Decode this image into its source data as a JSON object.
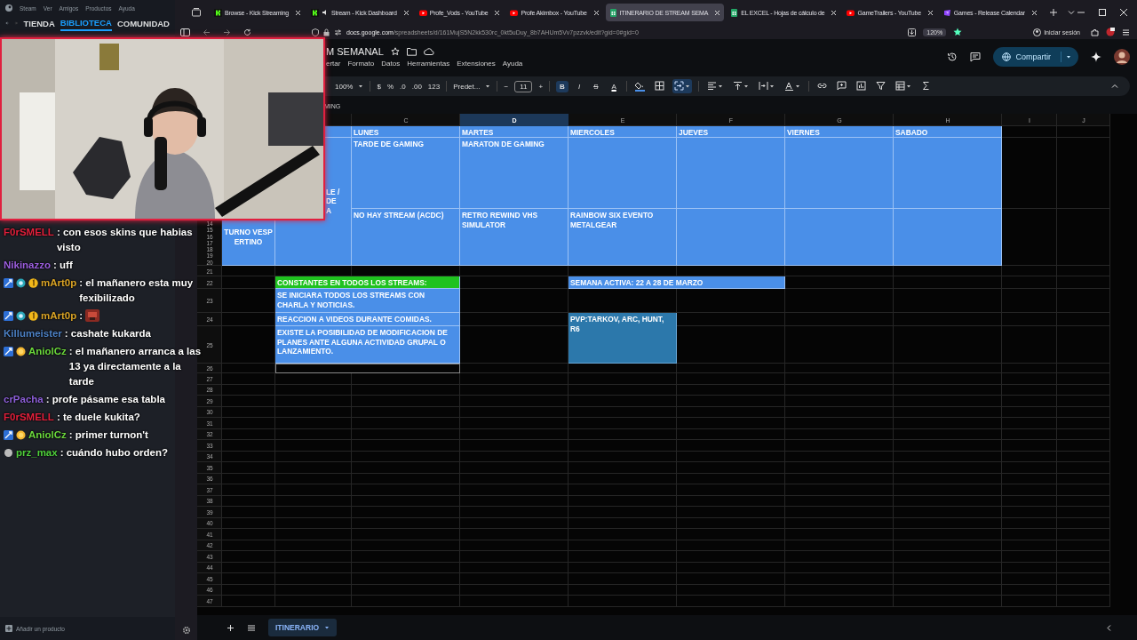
{
  "steam": {
    "menu": [
      "Steam",
      "Ver",
      "Amigos",
      "Productos",
      "Ayuda"
    ],
    "nav": [
      {
        "label": "TIENDA",
        "selected": false
      },
      {
        "label": "BIBLIOTECA",
        "selected": true
      },
      {
        "label": "COMUNIDAD",
        "selected": false
      }
    ],
    "add_product": "Añadir un producto"
  },
  "browser": {
    "tabs": [
      {
        "title": "Browse - Kick Streaming",
        "kind": "kick",
        "selected": false,
        "audio": false
      },
      {
        "title": "Stream - Kick Dashboard",
        "kind": "kick",
        "selected": false,
        "audio": true
      },
      {
        "title": "Profe_Vods - YouTube",
        "kind": "youtube",
        "selected": false,
        "audio": false
      },
      {
        "title": "Profe Akimbox - YouTube",
        "kind": "youtube",
        "selected": false,
        "audio": false
      },
      {
        "title": "ITINERARIO DE STREAM SEMA",
        "kind": "sheets",
        "selected": true,
        "audio": false
      },
      {
        "title": "EL EXCEL - Hojas de cálculo de",
        "kind": "sheets",
        "selected": false,
        "audio": false
      },
      {
        "title": "GameTrailers - YouTube",
        "kind": "youtube",
        "selected": false,
        "audio": false
      },
      {
        "title": "Games - Release Calendar",
        "kind": "games",
        "selected": false,
        "audio": false
      }
    ],
    "url": "docs.google.com/spreadsheets/d/161MujS5N2kk530rc_0kt5uDuy_8b7AHUm5Vv7pzzvk/edit?gid=0#gid=0",
    "zoom": "120%",
    "sign_in": "Iniciar sesión"
  },
  "sheet": {
    "title": "M SEMANAL",
    "menu": [
      "ertar",
      "Formato",
      "Datos",
      "Herramientas",
      "Extensiones",
      "Ayuda"
    ],
    "share": "Compartir",
    "toolbar": [
      {
        "kind": "dropdown",
        "label": "100%"
      },
      {
        "kind": "divider"
      },
      {
        "kind": "button",
        "label": "$"
      },
      {
        "kind": "button",
        "label": "%"
      },
      {
        "kind": "button",
        "label": ".0"
      },
      {
        "kind": "button",
        "label": ".00"
      },
      {
        "kind": "button",
        "label": "123"
      },
      {
        "kind": "divider"
      },
      {
        "kind": "dropdown",
        "label": "Predet..."
      },
      {
        "kind": "divider"
      },
      {
        "kind": "button",
        "label": "−"
      },
      {
        "kind": "field",
        "value": "11"
      },
      {
        "kind": "button",
        "label": "+"
      },
      {
        "kind": "divider"
      },
      {
        "kind": "toggle",
        "label": "B",
        "selected": true
      },
      {
        "kind": "toggle",
        "label": "I",
        "selected": false
      },
      {
        "kind": "toggle",
        "label": "S",
        "selected": false
      },
      {
        "kind": "toggle",
        "label": "A",
        "selected": false
      },
      {
        "kind": "divider"
      },
      {
        "kind": "icon",
        "selected": false
      },
      {
        "kind": "icon",
        "selected": false
      },
      {
        "kind": "icon",
        "selected": true
      },
      {
        "kind": "divider"
      },
      {
        "kind": "icon",
        "selected": false
      },
      {
        "kind": "icon",
        "selected": false
      },
      {
        "kind": "icon",
        "selected": false
      },
      {
        "kind": "icon",
        "selected": false
      },
      {
        "kind": "divider"
      },
      {
        "kind": "icon",
        "selected": false
      },
      {
        "kind": "icon",
        "selected": false
      },
      {
        "kind": "icon",
        "selected": false
      },
      {
        "kind": "icon",
        "selected": false
      },
      {
        "kind": "icon",
        "selected": false
      },
      {
        "kind": "icon",
        "selected": false
      }
    ],
    "formula": "MING",
    "columns": [
      {
        "label": "C",
        "selected": false
      },
      {
        "label": "D",
        "selected": true
      },
      {
        "label": "E",
        "selected": false
      },
      {
        "label": "F",
        "selected": false
      },
      {
        "label": "G",
        "selected": false
      },
      {
        "label": "H",
        "selected": false
      },
      {
        "label": "I",
        "selected": false
      },
      {
        "label": "J",
        "selected": false
      }
    ],
    "rows": [
      {
        "cells": [
          {
            "kind": "blank"
          },
          {
            "kind": "blue"
          },
          {
            "kind": "blue",
            "text": "LUNES"
          },
          {
            "kind": "blue",
            "text": "MARTES"
          },
          {
            "kind": "blue",
            "text": "MIERCOLES"
          },
          {
            "kind": "blue",
            "text": "JUEVES"
          },
          {
            "kind": "blue",
            "text": "VIERNES"
          },
          {
            "kind": "blue",
            "text": "SABADO"
          },
          {
            "kind": "blank"
          },
          {
            "kind": "blank"
          }
        ]
      },
      {
        "cells": [
          {
            "kind": "blank"
          },
          {
            "kind": "blue",
            "lines": [
              "LE /",
              "DE",
              "A"
            ]
          },
          {
            "kind": "blue",
            "text": "TARDE DE GAMING"
          },
          {
            "kind": "blue",
            "text": "MARATON DE GAMING"
          },
          {
            "kind": "blue"
          },
          {
            "kind": "blue"
          },
          {
            "kind": "blue"
          },
          {
            "kind": "blue"
          },
          {
            "kind": "blank"
          },
          {
            "kind": "blank"
          }
        ]
      },
      {
        "numbers": [
          "14",
          "15",
          "16",
          "17",
          "18",
          "19",
          "20"
        ],
        "cells": [
          {
            "kind": "blue",
            "text": "TURNO VESPERTINO",
            "centered": true
          },
          {
            "kind": "blue",
            "text": "NO HAY STREAM (ACDC)"
          },
          {
            "kind": "blue",
            "text": "RETRO REWIND VHS SIMULATOR"
          },
          {
            "kind": "blue",
            "text": "RAINBOW SIX EVENTO METALGEAR"
          },
          {
            "kind": "blue"
          },
          {
            "kind": "blue"
          },
          {
            "kind": "blue"
          },
          {
            "kind": "blank"
          },
          {
            "kind": "blank"
          }
        ]
      },
      {
        "numbers": [
          "21"
        ]
      },
      {
        "numbers": [
          "22"
        ],
        "cells": [
          {
            "kind": "blank"
          },
          {
            "kind": "green",
            "text": "CONSTANTES EN TODOS LOS STREAMS:"
          },
          {
            "kind": "blank"
          },
          {
            "kind": "blue",
            "text": "SEMANA ACTIVA: 22 A 28 DE MARZO"
          },
          {
            "kind": "blank"
          },
          {
            "kind": "blank"
          },
          {
            "kind": "blank"
          },
          {
            "kind": "blank"
          }
        ]
      },
      {
        "numbers": [
          "23"
        ],
        "cells": [
          {
            "kind": "blank"
          },
          {
            "kind": "blue",
            "text": "SE INICIARA TODOS LOS STREAMS CON CHARLA Y NOTICIAS."
          },
          {
            "kind": "blank"
          },
          {
            "kind": "blank"
          },
          {
            "kind": "blank"
          },
          {
            "kind": "blank"
          },
          {
            "kind": "blank"
          },
          {
            "kind": "blank"
          },
          {
            "kind": "blank"
          }
        ]
      },
      {
        "numbers": [
          "24"
        ],
        "cells": [
          {
            "kind": "blank"
          },
          {
            "kind": "blue",
            "text": "REACCION A VIDEOS DURANTE COMIDAS."
          },
          {
            "kind": "blank"
          },
          {
            "kind": "teal",
            "text": "PVP:TARKOV, ARC, HUNT, R6"
          },
          {
            "kind": "blank"
          },
          {
            "kind": "blank"
          },
          {
            "kind": "blank"
          },
          {
            "kind": "blank"
          },
          {
            "kind": "blank"
          }
        ]
      },
      {
        "numbers": [
          "25"
        ],
        "cells": [
          {
            "kind": "blank"
          },
          {
            "kind": "blue",
            "text": "EXISTE LA POSIBILIDAD DE MODIFICACION DE PLANES ANTE ALGUNA ACTIVIDAD GRUPAL O LANZAMIENTO."
          },
          {
            "kind": "blank"
          },
          {
            "kind": "blank"
          },
          {
            "kind": "blank"
          },
          {
            "kind": "blank"
          },
          {
            "kind": "blank"
          },
          {
            "kind": "blank"
          }
        ]
      },
      {
        "numbers": [
          "26"
        ],
        "cells": [
          {
            "kind": "blank"
          },
          {
            "kind": "outline"
          },
          {
            "kind": "blank"
          },
          {
            "kind": "blank"
          },
          {
            "kind": "blank"
          },
          {
            "kind": "blank"
          },
          {
            "kind": "blank"
          },
          {
            "kind": "blank"
          },
          {
            "kind": "blank"
          }
        ]
      },
      {
        "numbers": [
          "27"
        ]
      },
      {
        "numbers": [
          "28"
        ]
      },
      {
        "numbers": [
          "29"
        ]
      },
      {
        "numbers": [
          "30"
        ]
      },
      {
        "numbers": [
          "31"
        ]
      },
      {
        "numbers": [
          "32"
        ]
      },
      {
        "numbers": [
          "33"
        ]
      },
      {
        "numbers": [
          "34"
        ]
      },
      {
        "numbers": [
          "35"
        ]
      },
      {
        "numbers": [
          "36"
        ]
      },
      {
        "numbers": [
          "37"
        ]
      },
      {
        "numbers": [
          "38"
        ]
      },
      {
        "numbers": [
          "39"
        ]
      },
      {
        "numbers": [
          "40"
        ]
      },
      {
        "numbers": [
          "41"
        ]
      },
      {
        "numbers": [
          "42"
        ]
      },
      {
        "numbers": [
          "43"
        ]
      },
      {
        "numbers": [
          "44"
        ]
      },
      {
        "numbers": [
          "45"
        ]
      },
      {
        "numbers": [
          "46"
        ]
      },
      {
        "numbers": [
          "47"
        ]
      }
    ],
    "sheet_tabs": [
      {
        "label": "ITINERARIO",
        "selected": true
      }
    ]
  },
  "chat": [
    {
      "user": "F0rSMELL",
      "color": "#e3203c",
      "text": ": con esos skins que habias visto"
    },
    {
      "user": "Nikinazzo",
      "color": "#9d5fe0",
      "text": ": uff"
    },
    {
      "user": "mArt0p",
      "color": "#d9a326",
      "badges": [
        {
          "kind": "mod"
        },
        {
          "kind": "drops"
        },
        {
          "kind": "sub"
        }
      ],
      "text": ": el mañanero esta muy fexibilizado"
    },
    {
      "user": "mArt0p",
      "color": "#d9a326",
      "badges": [
        {
          "kind": "mod"
        },
        {
          "kind": "drops"
        },
        {
          "kind": "sub"
        }
      ],
      "text": ":",
      "emote": true
    },
    {
      "user": "Killumeister",
      "color": "#4d82c6",
      "text": ": cashate kukarda"
    },
    {
      "user": "AniolCz",
      "color": "#6bd83c",
      "badges": [
        {
          "kind": "mod"
        },
        {
          "kind": "coin"
        }
      ],
      "text": ": el mañanero arranca a las 13 ya directamente a la tarde"
    },
    {
      "user": "crPacha",
      "color": "#8c5fd8",
      "text": ": profe pásame esa tabla"
    },
    {
      "user": "F0rSMELL",
      "color": "#e3203c",
      "text": ": te duele kukita?"
    },
    {
      "user": "AniolCz",
      "color": "#6bd83c",
      "badges": [
        {
          "kind": "mod"
        },
        {
          "kind": "coin"
        }
      ],
      "text": ": primer turnon't"
    },
    {
      "user": "prz_max",
      "color": "#4fd03c",
      "badges": [
        {
          "kind": "grey"
        }
      ],
      "text": ": cuándo hubo orden?"
    }
  ]
}
